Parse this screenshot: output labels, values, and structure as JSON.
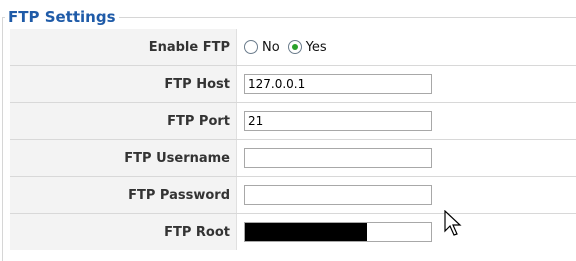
{
  "section": {
    "legend": "FTP Settings"
  },
  "fields": [
    {
      "label": "Enable FTP",
      "type": "radio",
      "options": [
        {
          "label": "No",
          "checked": false
        },
        {
          "label": "Yes",
          "checked": true
        }
      ]
    },
    {
      "label": "FTP Host",
      "type": "text",
      "value": "127.0.0.1"
    },
    {
      "label": "FTP Port",
      "type": "text",
      "value": "21"
    },
    {
      "label": "FTP Username",
      "type": "text",
      "value": ""
    },
    {
      "label": "FTP Password",
      "type": "text",
      "value": ""
    },
    {
      "label": "FTP Root",
      "type": "redacted",
      "value": ""
    }
  ],
  "icons": {
    "cursor": "arrow-cursor-icon"
  }
}
